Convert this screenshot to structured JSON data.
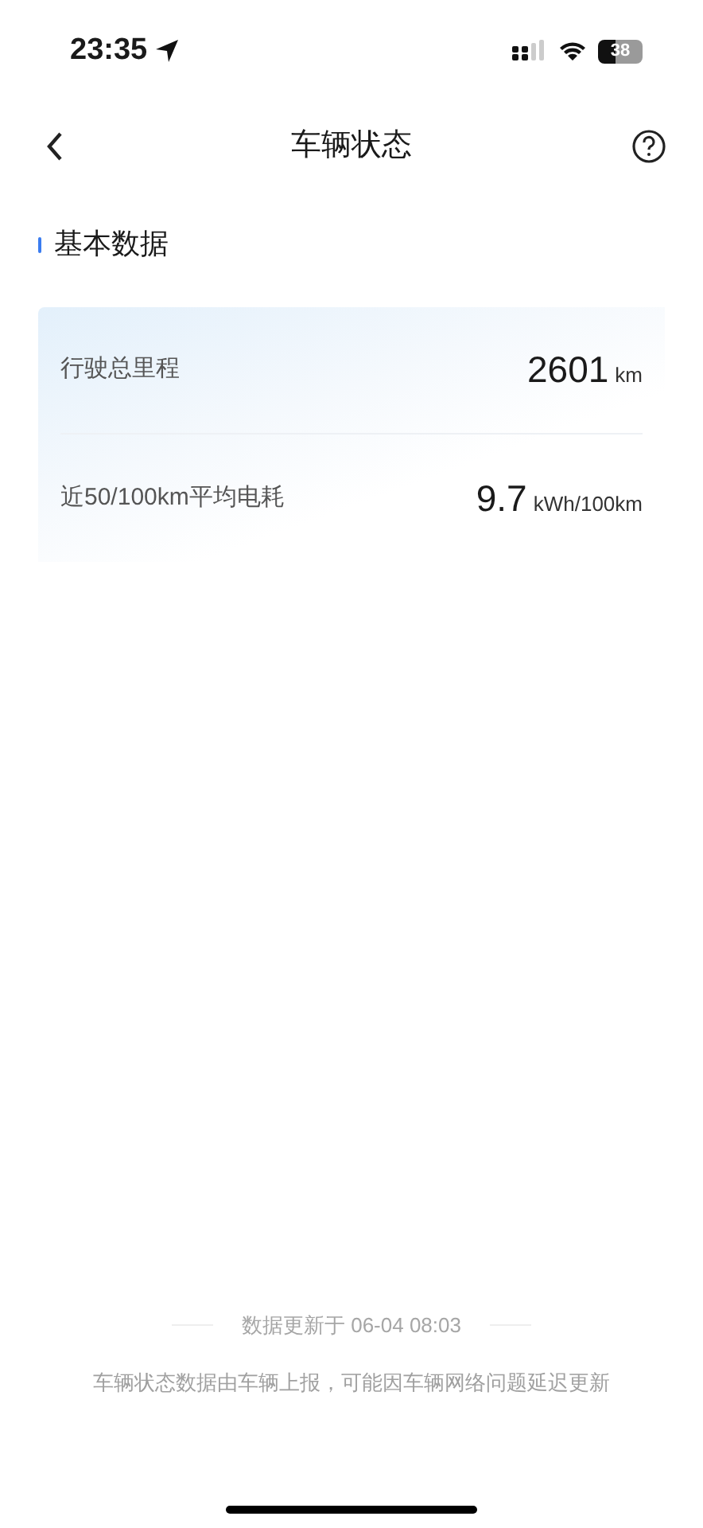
{
  "status_bar": {
    "time": "23:35",
    "battery": "38"
  },
  "nav": {
    "title": "车辆状态"
  },
  "section": {
    "title": "基本数据"
  },
  "metrics": [
    {
      "label": "行驶总里程",
      "value": "2601",
      "unit": "km"
    },
    {
      "label": "近50/100km平均电耗",
      "value": "9.7",
      "unit": "kWh/100km"
    }
  ],
  "footer": {
    "updated": "数据更新于 06-04 08:03",
    "note": "车辆状态数据由车辆上报，可能因车辆网络问题延迟更新"
  }
}
